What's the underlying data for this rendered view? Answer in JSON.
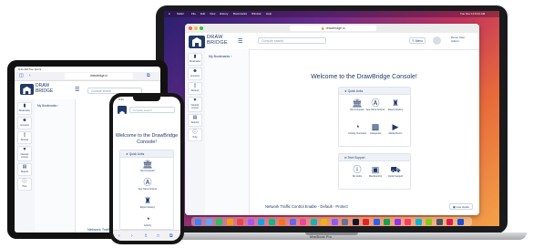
{
  "brand": {
    "line1": "DRAW",
    "line2": "BRIDGE"
  },
  "mac": {
    "menubar": {
      "items": [
        "Safari",
        "File",
        "Edit",
        "View",
        "History",
        "Bookmarks",
        "Window",
        "Help"
      ],
      "clock": "Tue Nov 10  9:41 AM"
    },
    "url": "drawbridge.io",
    "search_placeholder": "Console search",
    "menu_button": "☰ Menu",
    "user": {
      "name": "Demo User",
      "role": "Admin"
    },
    "nav": [
      {
        "icon": "bookmark-icon",
        "glyph": "▮",
        "label": "Bookmarks"
      },
      {
        "icon": "accounts-icon",
        "glyph": "☻",
        "label": "Accounts"
      },
      {
        "icon": "devices-icon",
        "glyph": "▯",
        "label": "Devices"
      },
      {
        "icon": "network-icon",
        "glyph": "▼",
        "label": "Network Access"
      },
      {
        "icon": "reports-icon",
        "glyph": "▤",
        "label": "Reports"
      },
      {
        "icon": "help-icon",
        "glyph": "ⓘ",
        "label": "Help"
      }
    ],
    "bookmarks_title": "My Bookmarks ›",
    "welcome": "Welcome to the DrawBridge Console!",
    "quick_links": {
      "title": "★ Quick Links",
      "tiles": [
        {
          "icon": "bank-icon",
          "glyph": "⌂",
          "label": "My Computer"
        },
        {
          "icon": "app-store-icon",
          "glyph": "Ⓐ",
          "label": "App Store Access"
        },
        {
          "icon": "report-history-icon",
          "glyph": "♜",
          "label": "Report History"
        },
        {
          "icon": "activity-icon",
          "glyph": "◔",
          "label": "Activity Overview"
        },
        {
          "icon": "categories-icon",
          "glyph": "▩",
          "label": "Categories"
        },
        {
          "icon": "media-icon",
          "glyph": "▶",
          "label": "Media Room"
        }
      ]
    },
    "tech_support": {
      "title": "⚙ Tech Support",
      "tiles": [
        {
          "icon": "faq-icon",
          "glyph": "ⓘ",
          "label": "My Hubs"
        },
        {
          "icon": "monitor-icon",
          "glyph": "▣",
          "label": "Membership"
        },
        {
          "icon": "truck-icon",
          "glyph": "⛟",
          "label": "Quick Support"
        }
      ]
    },
    "status": "Network Traffic Control Enable - Default - Protect",
    "status_button": "▣ Live Guide",
    "model": "MacBook Pro",
    "dock_colors": [
      "#3b82f6",
      "#60a5fa",
      "#22c55e",
      "#f59e0b",
      "#ef4444",
      "#a855f7",
      "#0ea5e9",
      "#10b981",
      "#f97316",
      "#6366f1",
      "#ec4899",
      "#14b8a6",
      "#eab308",
      "#8b5cf6",
      "#64748b",
      "#0f172a",
      "#dc2626",
      "#2563eb",
      "#16a34a",
      "#9333ea",
      "#f43f5e",
      "#06b6d4",
      "#84cc16",
      "#475569",
      "#e11d48",
      "#1d4ed8"
    ]
  },
  "ipad": {
    "status": "9:41 AM  Tue Jan 9",
    "url": "drawbridge.io",
    "search_placeholder": "Console search",
    "bookmarks_title": "My Bookmarks ›",
    "nav_labels": [
      "Bookmarks",
      "Accounts",
      "Devices",
      "Network Access",
      "Reports",
      "Help"
    ],
    "status_text": "Network Traffic"
  },
  "iphone": {
    "time": "9:41",
    "search_placeholder": "Console search",
    "welcome": "Welcome to the DrawBridge Console!",
    "quick_links_title": "★ Quick Links",
    "tiles": [
      {
        "icon": "bank-icon",
        "glyph": "⌂",
        "label": "My Computer"
      },
      {
        "icon": "app-store-icon",
        "glyph": "Ⓐ",
        "label": "App Store Access"
      },
      {
        "icon": "report-history-icon",
        "glyph": "♜",
        "label": "Report History"
      },
      {
        "icon": "activity-icon",
        "glyph": "◔",
        "label": "Activity"
      }
    ],
    "bottom_bar": [
      "‹",
      "›",
      "⇪",
      "□",
      "⧉"
    ]
  }
}
